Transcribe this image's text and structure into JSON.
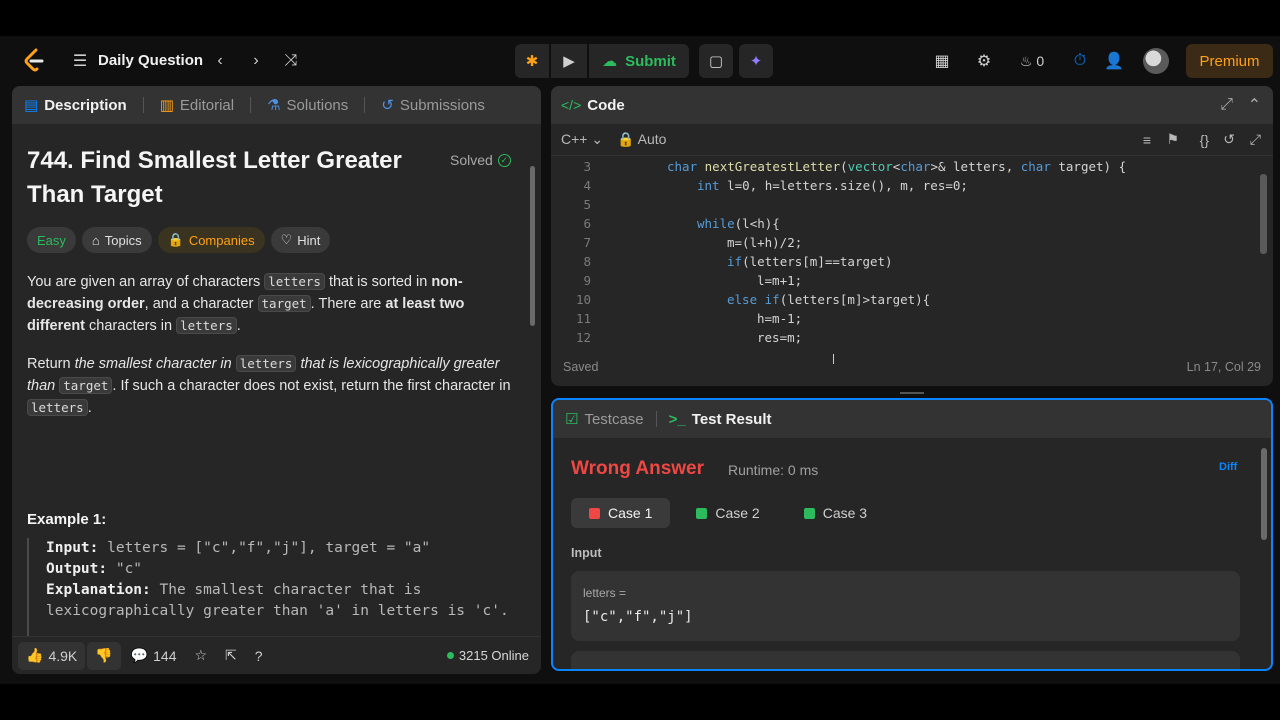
{
  "topbar": {
    "title": "Daily Question",
    "submit_label": "Submit",
    "streak": "0",
    "premium_label": "Premium"
  },
  "desc_tabs": [
    "Description",
    "Editorial",
    "Solutions",
    "Submissions"
  ],
  "problem": {
    "title": "744. Find Smallest Letter Greater Than Target",
    "solved_label": "Solved",
    "tags": [
      "Easy",
      "Topics",
      "Companies",
      "Hint"
    ],
    "p1": [
      "You are given an array of characters ",
      "letters",
      " that is sorted in ",
      "non-decreasing order",
      ", and a character ",
      "target",
      ". There are ",
      "at least two different",
      " characters in ",
      "letters",
      "."
    ],
    "p2": [
      "Return ",
      "the smallest character in ",
      "letters",
      " that is lexicographically greater than ",
      "target",
      ". If such a character does not exist, return the first character in ",
      "letters",
      "."
    ],
    "example_title": "Example 1:",
    "example": {
      "input_label": "Input:",
      "input": " letters = [\"c\",\"f\",\"j\"], target = \"a\"",
      "output_label": "Output:",
      "output": " \"c\"",
      "expl_label": "Explanation:",
      "expl": " The smallest character that is lexicographically greater than 'a' in letters is 'c'."
    }
  },
  "desc_footer": {
    "likes": "4.9K",
    "comments": "144",
    "online": "3215 Online"
  },
  "code": {
    "header": "Code",
    "language": "C++",
    "mode": "Auto",
    "status": "Saved",
    "cursor_pos": "Ln 17, Col 29",
    "lines": [
      {
        "n": "3",
        "indent": 1,
        "parts": [
          [
            "kw",
            "char"
          ],
          [
            "tx",
            " "
          ],
          [
            "fn",
            "nextGreatestLetter"
          ],
          [
            "tx",
            "("
          ],
          [
            "ty",
            "vector"
          ],
          [
            "tx",
            "<"
          ],
          [
            "kw",
            "char"
          ],
          [
            "tx",
            ">& letters, "
          ],
          [
            "kw",
            "char"
          ],
          [
            "tx",
            " target) {"
          ]
        ]
      },
      {
        "n": "4",
        "indent": 2,
        "parts": [
          [
            "kw",
            "int"
          ],
          [
            "tx",
            " l=0, h=letters.size(), m, res=0;"
          ]
        ]
      },
      {
        "n": "5",
        "indent": 0,
        "parts": []
      },
      {
        "n": "6",
        "indent": 2,
        "parts": [
          [
            "kw",
            "while"
          ],
          [
            "tx",
            "(l<h){"
          ]
        ]
      },
      {
        "n": "7",
        "indent": 3,
        "parts": [
          [
            "tx",
            "m=(l+h)/2;"
          ]
        ]
      },
      {
        "n": "8",
        "indent": 3,
        "parts": [
          [
            "kw",
            "if"
          ],
          [
            "tx",
            "(letters[m]==target)"
          ]
        ]
      },
      {
        "n": "9",
        "indent": 4,
        "parts": [
          [
            "tx",
            "l=m+1;"
          ]
        ]
      },
      {
        "n": "10",
        "indent": 3,
        "parts": [
          [
            "kw",
            "else if"
          ],
          [
            "tx",
            "(letters[m]>target){"
          ]
        ]
      },
      {
        "n": "11",
        "indent": 4,
        "parts": [
          [
            "tx",
            "h=m-1;"
          ]
        ]
      },
      {
        "n": "12",
        "indent": 4,
        "parts": [
          [
            "tx",
            "res=m;"
          ]
        ]
      }
    ]
  },
  "result": {
    "tabs": [
      "Testcase",
      "Test Result"
    ],
    "verdict": "Wrong Answer",
    "runtime": "Runtime: 0 ms",
    "diff": "Diff",
    "cases": [
      "Case 1",
      "Case 2",
      "Case 3"
    ],
    "input_label": "Input",
    "var_name": "letters =",
    "var_value": "[\"c\",\"f\",\"j\"]"
  },
  "colors": {
    "accent_green": "#2cbb5d",
    "error_red": "#ef4743",
    "premium_orange": "#ffa116",
    "focus_blue": "#0a84ff"
  }
}
